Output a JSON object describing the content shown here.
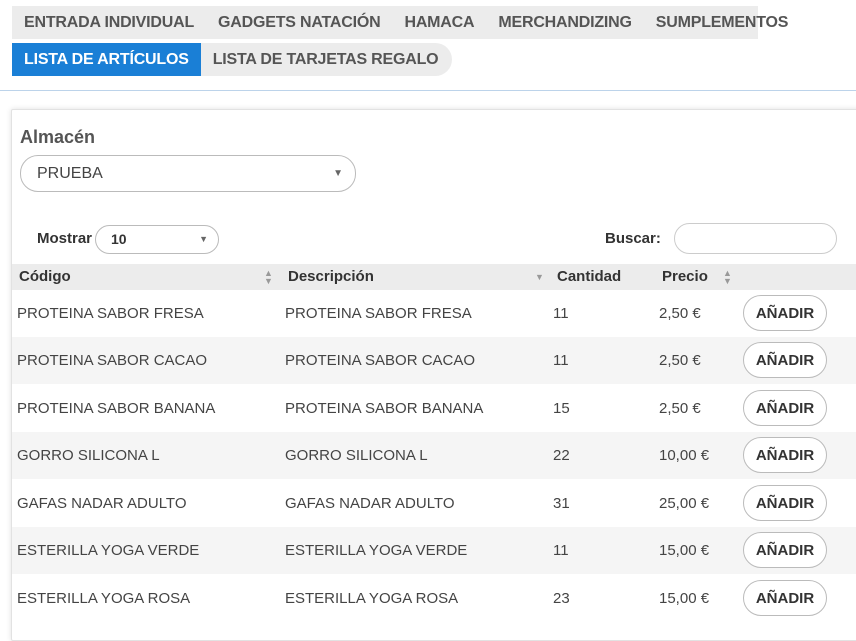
{
  "tabs": {
    "row1": [
      "ENTRADA INDIVIDUAL",
      "GADGETS NATACIÓN",
      "HAMACA",
      "MERCHANDIZING",
      "SUMPLEMENTOS"
    ],
    "row2": [
      {
        "label": "LISTA DE ARTÍCULOS",
        "active": true
      },
      {
        "label": "LISTA DE TARJETAS REGALO",
        "active": false
      }
    ]
  },
  "almacen": {
    "label": "Almacén",
    "value": "PRUEBA"
  },
  "controls": {
    "mostrar_label": "Mostrar",
    "mostrar_value": "10",
    "buscar_label": "Buscar:",
    "buscar_value": ""
  },
  "table": {
    "headers": {
      "codigo": "Código",
      "descripcion": "Descripción",
      "cantidad": "Cantidad",
      "precio": "Precio"
    },
    "add_label": "AÑADIR",
    "rows": [
      {
        "codigo": "PROTEINA SABOR FRESA",
        "descripcion": "PROTEINA SABOR FRESA",
        "cantidad": "11",
        "precio": "2,50 €"
      },
      {
        "codigo": "PROTEINA SABOR CACAO",
        "descripcion": "PROTEINA SABOR CACAO",
        "cantidad": "11",
        "precio": "2,50 €"
      },
      {
        "codigo": "PROTEINA SABOR BANANA",
        "descripcion": "PROTEINA SABOR BANANA",
        "cantidad": "15",
        "precio": "2,50 €"
      },
      {
        "codigo": "GORRO SILICONA L",
        "descripcion": "GORRO SILICONA L",
        "cantidad": "22",
        "precio": "10,00 €"
      },
      {
        "codigo": "GAFAS NADAR ADULTO",
        "descripcion": "GAFAS NADAR ADULTO",
        "cantidad": "31",
        "precio": "25,00 €"
      },
      {
        "codigo": "ESTERILLA YOGA VERDE",
        "descripcion": "ESTERILLA YOGA VERDE",
        "cantidad": "11",
        "precio": "15,00 €"
      },
      {
        "codigo": "ESTERILLA YOGA ROSA",
        "descripcion": "ESTERILLA YOGA ROSA",
        "cantidad": "23",
        "precio": "15,00 €"
      }
    ]
  },
  "colors": {
    "accent": "#1a7fd6",
    "tab_bg": "#ececec",
    "row_alt": "#f5f5f5"
  }
}
